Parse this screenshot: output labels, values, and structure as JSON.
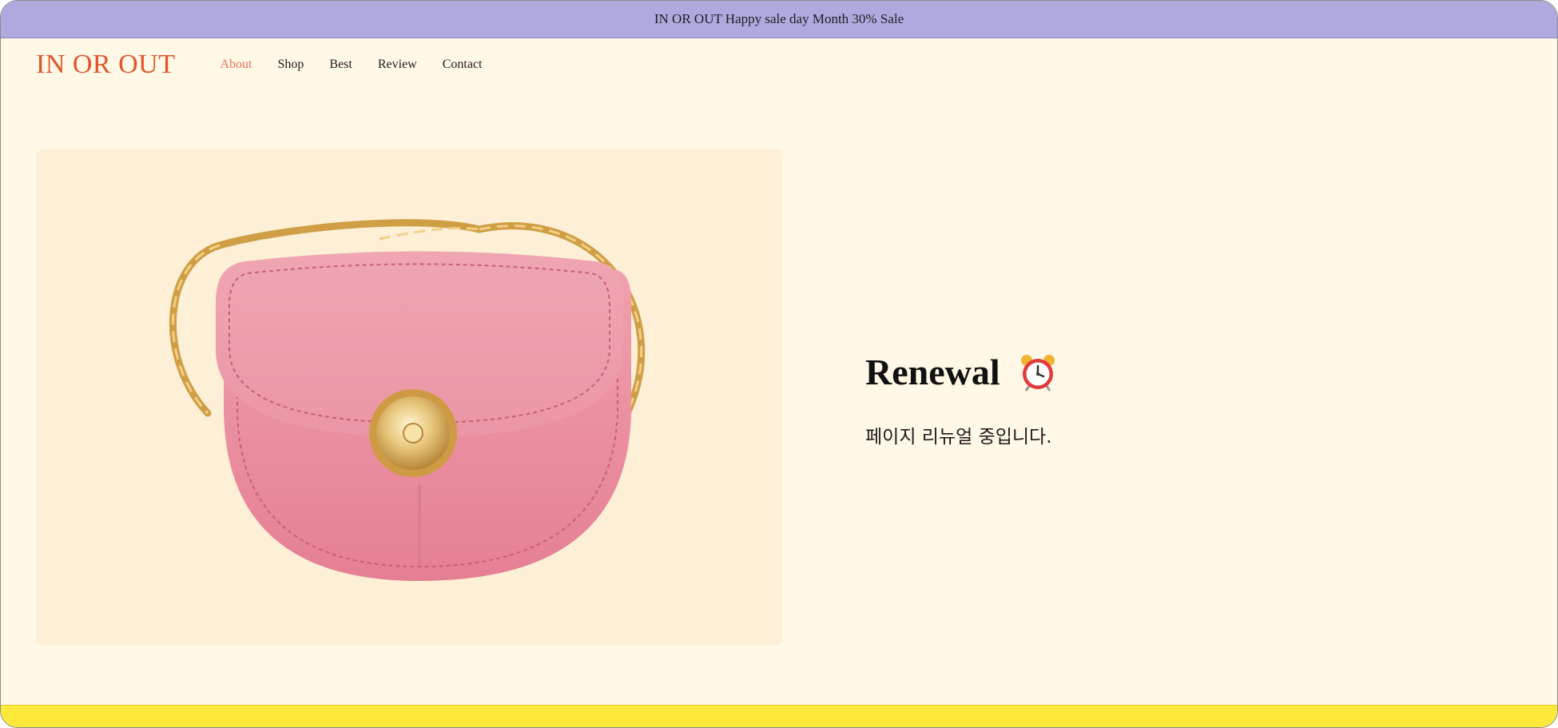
{
  "promo": {
    "text": "IN OR OUT Happy sale day Month 30% Sale"
  },
  "header": {
    "logo": "IN OR OUT",
    "nav": [
      "About",
      "Shop",
      "Best",
      "Review",
      "Contact"
    ],
    "active_nav": "About"
  },
  "hero": {
    "image": "pink-handbag-with-gold-chain",
    "title": "Renewal",
    "title_icon": "alarm-clock-icon",
    "subtitle": "페이지 리뉴얼 중입니다."
  },
  "colors": {
    "promo_bar": "#aeaadf",
    "page_background": "#fff8e6",
    "logo": "#e0562b",
    "active_nav": "#e8735a",
    "footer_bar": "#fde93a"
  }
}
